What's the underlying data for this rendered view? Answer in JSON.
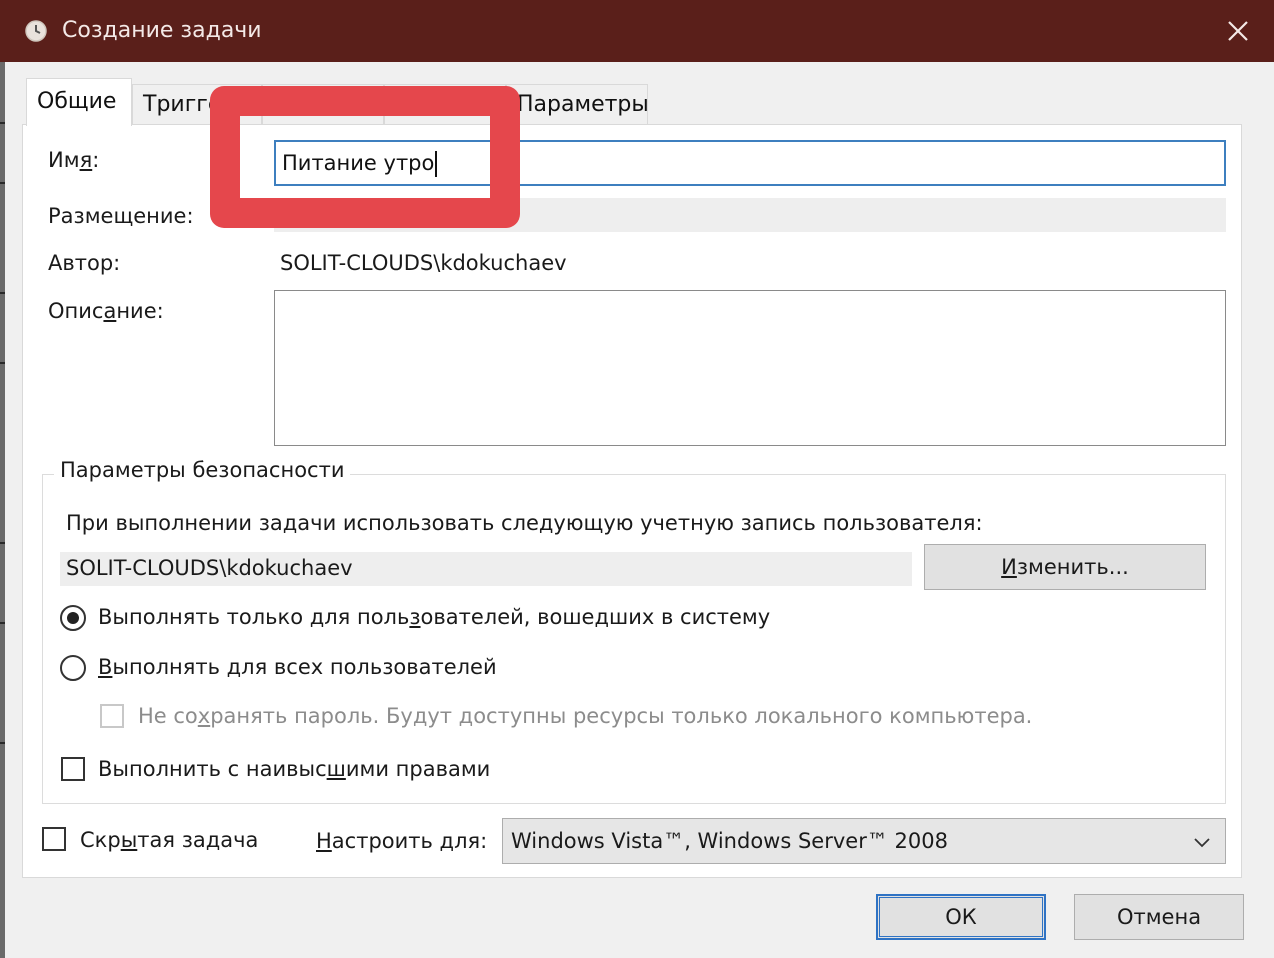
{
  "window": {
    "title": "Создание задачи",
    "icon": "clock-icon",
    "close": "close-icon"
  },
  "tabs": [
    {
      "label": "Общие",
      "active": true
    },
    {
      "label": "Тригге",
      "active": false
    },
    {
      "label": "",
      "active": false
    },
    {
      "label": "",
      "active": false
    },
    {
      "label": "Параметры",
      "active": false
    }
  ],
  "general": {
    "name_label": "Имя:",
    "name_value": "Питание утро",
    "placement_label": "Размещение:",
    "placement_value": "",
    "author_label": "Автор:",
    "author_value": "SOLIT-CLOUDS\\kdokuchaev",
    "description_label": "Описание:",
    "description_value": ""
  },
  "security": {
    "group_title": "Параметры безопасности",
    "account_prompt": "При выполнении задачи использовать следующую учетную запись пользователя:",
    "account_value": "SOLIT-CLOUDS\\kdokuchaev",
    "change_button": "Изменить...",
    "radio_logged_on": {
      "label": "Выполнять только для пользователей, вошедших в систему",
      "checked": true
    },
    "radio_all_users": {
      "label": "Выполнять для всех пользователей",
      "checked": false
    },
    "no_store_password": {
      "label": "Не сохранять пароль. Будут доступны ресурсы только локального компьютера.",
      "checked": false,
      "enabled": false
    },
    "highest_privileges": {
      "label": "Выполнить с наивысшими правами",
      "checked": false
    }
  },
  "footer": {
    "hidden_task": {
      "label": "Скрытая задача",
      "checked": false
    },
    "configure_label": "Настроить для:",
    "configure_value": "Windows Vista™, Windows Server™ 2008",
    "ok_button": "ОК",
    "cancel_button": "Отмена"
  },
  "colors": {
    "titlebar": "#5a1f1a",
    "focus_border": "#3d7fbf",
    "highlight": "#e5474c"
  }
}
